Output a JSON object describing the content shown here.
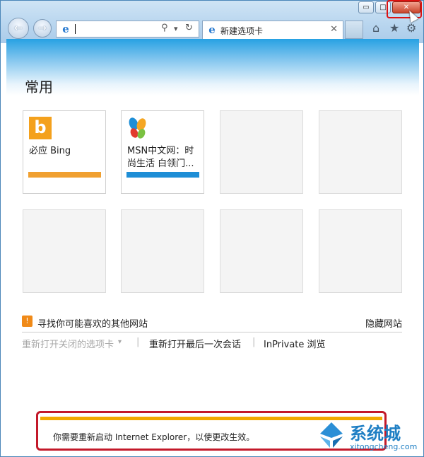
{
  "window": {
    "caption": {
      "minimize": "▭",
      "maximize": "□",
      "close": "✕"
    }
  },
  "nav": {
    "back_icon": "←",
    "forward_icon": "→"
  },
  "address_bar": {
    "value": "",
    "search_icon": "⚲",
    "dropdown_icon": "▾",
    "refresh_icon": "↻"
  },
  "tab": {
    "label": "新建选项卡",
    "close": "✕"
  },
  "toolbar": {
    "home_icon": "⌂",
    "favorites_icon": "★",
    "settings_icon": "⚙"
  },
  "page": {
    "heading": "常用",
    "tiles": [
      {
        "title": "必应 Bing",
        "bar_color": "#f0a030"
      },
      {
        "title": "MSN中文网：时尚生活 白领门...",
        "bar_color": "#1e8ed6"
      }
    ],
    "suggest_text": "寻找你可能喜欢的其他网站",
    "hide_link": "隐藏网站",
    "reopen_closed_tabs": "重新打开关闭的选项卡",
    "reopen_closed_tabs_arrow": "▾",
    "separator": "|",
    "reopen_last_session": "重新打开最后一次会话",
    "inprivate": "InPrivate 浏览"
  },
  "notification": {
    "message": "你需要重新启动 Internet Explorer，以使更改生效。"
  },
  "watermark": {
    "brand": "系统城",
    "url": "xitongcheng.com"
  },
  "colors": {
    "accent": "#27a1e3",
    "notification_border": "#f2a900",
    "highlight": "#d11111"
  }
}
